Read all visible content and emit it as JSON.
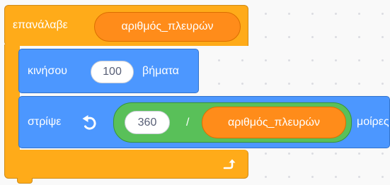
{
  "repeat_block": {
    "label": "επανάλαβε",
    "count_variable": "αριθμός_πλευρών",
    "loop_icon": "loop-arrow-icon"
  },
  "move_block": {
    "label": "κινήσου",
    "steps_value": "100",
    "suffix": "βήματα"
  },
  "turn_block": {
    "label": "στρίψε",
    "direction_icon": "rotate-left-icon",
    "operator": {
      "left_value": "360",
      "symbol": "/",
      "right_variable": "αριθμός_πλευρών"
    },
    "suffix": "μοίρες"
  },
  "colors": {
    "control": "#ffab19",
    "motion": "#4c97ff",
    "variable": "#ff8c1a",
    "operator": "#59c059",
    "canvas": "#f9f9f9"
  }
}
